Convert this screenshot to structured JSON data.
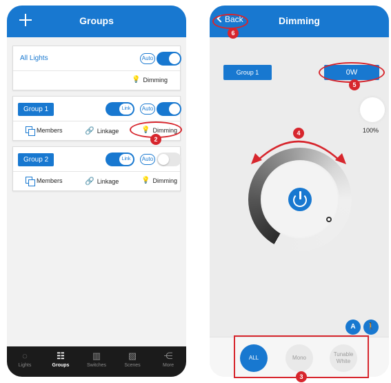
{
  "left": {
    "title": "Groups",
    "all_lights": {
      "label": "All Lights",
      "auto": "Auto",
      "dimming": "Dimming"
    },
    "groups": [
      {
        "name": "Group 1",
        "link": "Link",
        "auto": "Auto",
        "members": "Members",
        "linkage": "Linkage",
        "dimming": "Dimming",
        "switch_on": true
      },
      {
        "name": "Group 2",
        "link": "Link",
        "auto": "Auto",
        "members": "Members",
        "linkage": "Linkage",
        "dimming": "Dimming",
        "switch_on": false
      }
    ],
    "tabs": [
      {
        "label": "Lights",
        "icon": "bulb-icon"
      },
      {
        "label": "Groups",
        "icon": "groups-icon",
        "active": true
      },
      {
        "label": "Switches",
        "icon": "switch-icon"
      },
      {
        "label": "Scenes",
        "icon": "scenes-icon"
      },
      {
        "label": "More",
        "icon": "share-icon"
      }
    ],
    "callout_dimming": "2"
  },
  "right": {
    "back": "Back",
    "title": "Dimming",
    "group": "Group 1",
    "power": "0W",
    "brightness": "100%",
    "modes": {
      "all": "ALL",
      "mono": "Mono",
      "tunable": "Tunable White"
    },
    "mode_icons": [
      "A",
      "🚶"
    ],
    "callouts": {
      "back": "6",
      "power": "5",
      "dial": "4",
      "modes": "3"
    }
  },
  "colors": {
    "primary": "#1878d0",
    "callout": "#d7262d",
    "tabbar": "#1b1b1b"
  }
}
